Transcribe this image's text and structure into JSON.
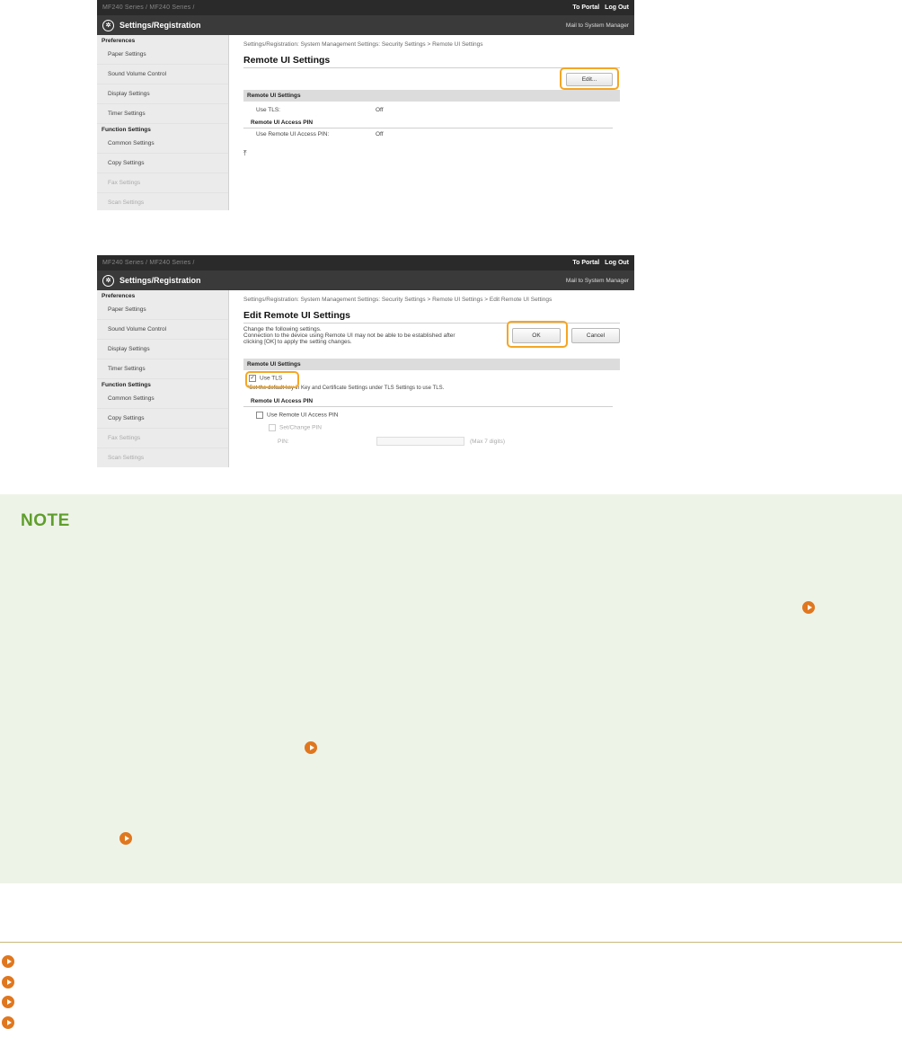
{
  "topbar": {
    "crumb": "MF240 Series / MF240 Series /",
    "portal_link": "To Portal",
    "logout_link": "Log Out"
  },
  "titlebar": {
    "title": "Settings/Registration",
    "mail": "Mail to System Manager"
  },
  "sidebar": {
    "section_preferences": "Preferences",
    "section_function": "Function Settings",
    "items_pref": [
      "Paper Settings",
      "Sound Volume Control",
      "Display Settings",
      "Timer Settings"
    ],
    "items_func": [
      "Common Settings",
      "Copy Settings",
      "Fax Settings",
      "Scan Settings"
    ]
  },
  "screen1": {
    "breadcrumb": "Settings/Registration: System Management Settings: Security Settings > Remote UI Settings",
    "page_title": "Remote UI Settings",
    "edit_button": "Edit...",
    "section": "Remote UI Settings",
    "use_tls_label": "Use TLS:",
    "use_tls_value": "Off",
    "pin_section": "Remote UI Access PIN",
    "pin_label": "Use Remote UI Access PIN:",
    "pin_value": "Off",
    "top_icon": "back-to-top-icon"
  },
  "screen2": {
    "breadcrumb": "Settings/Registration: System Management Settings: Security Settings > Remote UI Settings > Edit Remote UI Settings",
    "page_title": "Edit Remote UI Settings",
    "desc1": "Change the following settings.",
    "desc2": "Connection to the device using Remote UI may not be able to be established after",
    "desc3": "clicking [OK] to apply the setting changes.",
    "ok_button": "OK",
    "cancel_button": "Cancel",
    "section": "Remote UI Settings",
    "use_tls_checkbox": "Use TLS",
    "tls_note": "*Set the default key in Key and Certificate Settings under TLS Settings to use TLS.",
    "pin_section": "Remote UI Access PIN",
    "use_pin_checkbox": "Use Remote UI Access PIN",
    "set_change_pin": "Set/Change PIN",
    "pin_label": "PIN:",
    "pin_hint": "(Max 7 digits)"
  },
  "note": {
    "title": "NOTE"
  },
  "colors": {
    "highlight": "#f5a623",
    "note_bg": "#eef3e8",
    "note_title": "#5f9e2c",
    "link_arrow": "#e0771e"
  }
}
